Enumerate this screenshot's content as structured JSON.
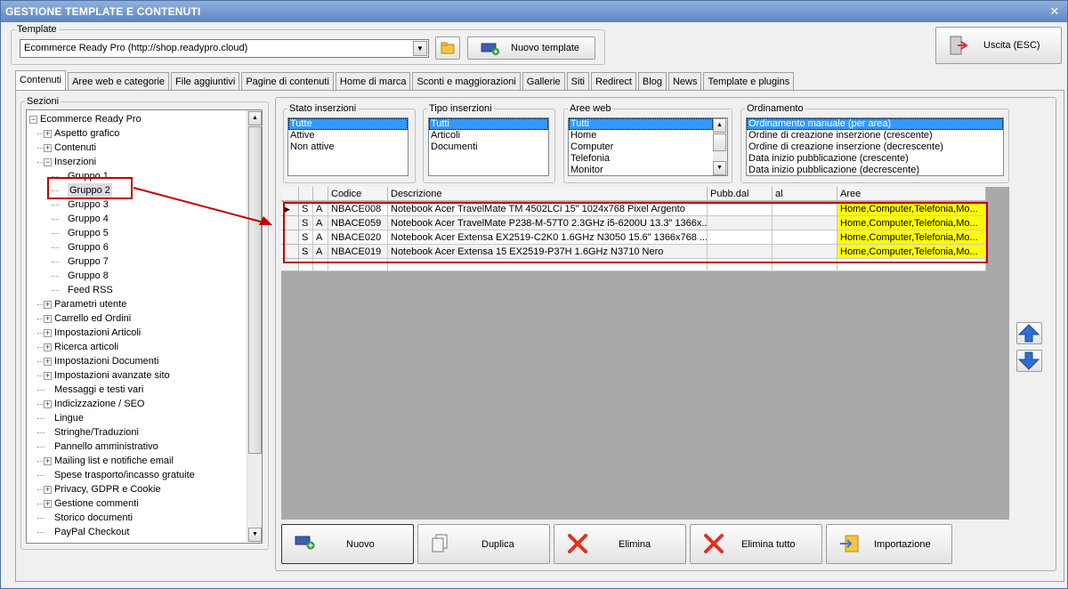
{
  "window": {
    "title": "GESTIONE TEMPLATE E CONTENUTI",
    "close_glyph": "✕"
  },
  "template_group": {
    "legend": "Template",
    "selected_value": "Ecommerce Ready Pro (http://shop.readypro.cloud)",
    "new_button": "Nuovo template"
  },
  "exit_button": "Uscita (ESC)",
  "tabs": [
    {
      "label": "Contenuti",
      "active": true
    },
    {
      "label": "Aree web e categorie"
    },
    {
      "label": "File aggiuntivi"
    },
    {
      "label": "Pagine di contenuti"
    },
    {
      "label": "Home di marca"
    },
    {
      "label": "Sconti e maggiorazioni"
    },
    {
      "label": "Gallerie"
    },
    {
      "label": "Siti"
    },
    {
      "label": "Redirect"
    },
    {
      "label": "Blog"
    },
    {
      "label": "News"
    },
    {
      "label": "Template e plugins"
    }
  ],
  "sezioni": {
    "legend": "Sezioni",
    "nodes": [
      {
        "label": "Ecommerce Ready Pro",
        "level": 0,
        "expander": "−"
      },
      {
        "label": "Aspetto grafico",
        "level": 1,
        "expander": "+"
      },
      {
        "label": "Contenuti",
        "level": 1,
        "expander": "+"
      },
      {
        "label": "Inserzioni",
        "level": 1,
        "expander": "−"
      },
      {
        "label": "Gruppo 1",
        "level": 2
      },
      {
        "label": "Gruppo 2",
        "level": 2,
        "selected": true
      },
      {
        "label": "Gruppo 3",
        "level": 2
      },
      {
        "label": "Gruppo 4",
        "level": 2
      },
      {
        "label": "Gruppo 5",
        "level": 2
      },
      {
        "label": "Gruppo 6",
        "level": 2
      },
      {
        "label": "Gruppo 7",
        "level": 2
      },
      {
        "label": "Gruppo 8",
        "level": 2
      },
      {
        "label": "Feed RSS",
        "level": 2
      },
      {
        "label": "Parametri utente",
        "level": 1,
        "expander": "+"
      },
      {
        "label": "Carrello ed Ordini",
        "level": 1,
        "expander": "+"
      },
      {
        "label": "Impostazioni Articoli",
        "level": 1,
        "expander": "+"
      },
      {
        "label": "Ricerca articoli",
        "level": 1,
        "expander": "+"
      },
      {
        "label": "Impostazioni Documenti",
        "level": 1,
        "expander": "+"
      },
      {
        "label": "Impostazioni avanzate sito",
        "level": 1,
        "expander": "+"
      },
      {
        "label": "Messaggi e testi vari",
        "level": 1
      },
      {
        "label": "Indicizzazione / SEO",
        "level": 1,
        "expander": "+"
      },
      {
        "label": "Lingue",
        "level": 1
      },
      {
        "label": "Stringhe/Traduzioni",
        "level": 1
      },
      {
        "label": "Pannello amministrativo",
        "level": 1
      },
      {
        "label": "Mailing list e notifiche email",
        "level": 1,
        "expander": "+"
      },
      {
        "label": "Spese trasporto/incasso gratuite",
        "level": 1
      },
      {
        "label": "Privacy, GDPR e Cookie",
        "level": 1,
        "expander": "+"
      },
      {
        "label": "Gestione commenti",
        "level": 1,
        "expander": "+"
      },
      {
        "label": "Storico documenti",
        "level": 1
      },
      {
        "label": "PayPal Checkout",
        "level": 1
      }
    ]
  },
  "filters": {
    "stato": {
      "legend": "Stato inserzioni",
      "items": [
        "Tutte",
        "Attive",
        "Non attive"
      ],
      "selected": 0
    },
    "tipo": {
      "legend": "Tipo inserzioni",
      "items": [
        "Tutti",
        "Articoli",
        "Documenti"
      ],
      "selected": 0
    },
    "aree": {
      "legend": "Aree web",
      "items": [
        "Tutti",
        "Home",
        "Computer",
        "Telefonia",
        "Monitor"
      ],
      "selected": 0
    },
    "ordinamento": {
      "legend": "Ordinamento",
      "items": [
        "Ordinamento manuale (per area)",
        "Ordine di creazione inserzione (crescente)",
        "Ordine di creazione inserzione (decrescente)",
        "Data inizio pubblicazione (crescente)",
        "Data inizio pubblicazione (decrescente)"
      ],
      "selected": 0
    }
  },
  "grid": {
    "columns": [
      "",
      "",
      "",
      "Codice",
      "Descrizione",
      "Pubb.dal",
      "al",
      "Aree"
    ],
    "rows": [
      {
        "marker": "▶",
        "s": "S",
        "a": "A",
        "codice": "NBACE008",
        "descrizione": "Notebook Acer TravelMate TM 4502LCi 15\" 1024x768 Pixel Argento",
        "pubb_dal": "",
        "al": "",
        "aree": "Home,Computer,Telefonia,Mo..."
      },
      {
        "marker": "",
        "s": "S",
        "a": "A",
        "codice": "NBACE059",
        "descrizione": "Notebook Acer TravelMate P238-M-57T0 2.3GHz i5-6200U 13.3\" 1366x...",
        "pubb_dal": "",
        "al": "",
        "aree": "Home,Computer,Telefonia,Mo..."
      },
      {
        "marker": "",
        "s": "S",
        "a": "A",
        "codice": "NBACE020",
        "descrizione": "Notebook Acer Extensa EX2519-C2K0 1.6GHz N3050 15.6\" 1366x768 ...",
        "pubb_dal": "",
        "al": "",
        "aree": "Home,Computer,Telefonia,Mo..."
      },
      {
        "marker": "",
        "s": "S",
        "a": "A",
        "codice": "NBACE019",
        "descrizione": "Notebook Acer Extensa 15 EX2519-P37H 1.6GHz N3710 Nero",
        "pubb_dal": "",
        "al": "",
        "aree": "Home,Computer,Telefonia,Mo..."
      }
    ]
  },
  "actions": {
    "nuovo": "Nuovo",
    "duplica": "Duplica",
    "elimina": "Elimina",
    "elimina_tutto": "Elimina tutto",
    "importazione": "Importazione"
  },
  "colors": {
    "highlight_red": "#c00000",
    "aree_yellow": "#ffff00",
    "selection_blue": "#3399ff"
  }
}
